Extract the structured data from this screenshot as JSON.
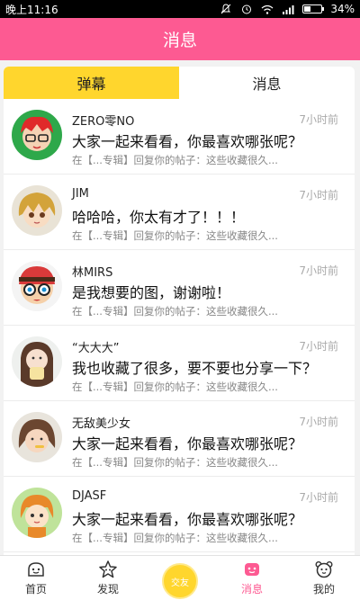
{
  "status_bar": {
    "time": "晚上11:16",
    "battery": "34%",
    "battery_level": 0.34
  },
  "header": {
    "title": "消息"
  },
  "tabs": [
    {
      "label": "弹幕",
      "active": true
    },
    {
      "label": "消息",
      "active": false
    }
  ],
  "messages": [
    {
      "user": "ZERO零NO",
      "time": "7小时前",
      "text": "大家一起来看看，你最喜欢哪张呢？",
      "sub": "在【...专辑】回复你的帖子：这些收藏很久..."
    },
    {
      "user": "JIM",
      "time": "7小时前",
      "text": "哈哈哈，你太有才了！！！",
      "sub": "在【...专辑】回复你的帖子：这些收藏很久..."
    },
    {
      "user": "林MIRS",
      "time": "7小时前",
      "text": "是我想要的图，谢谢啦！",
      "sub": "在【...专辑】回复你的帖子：这些收藏很久..."
    },
    {
      "user": "“大大大”",
      "time": "7小时前",
      "text": "我也收藏了很多，要不要也分享一下？",
      "sub": "在【...专辑】回复你的帖子：这些收藏很久..."
    },
    {
      "user": "无敌美少女",
      "time": "7小时前",
      "text": "大家一起来看看，你最喜欢哪张呢？",
      "sub": "在【...专辑】回复你的帖子：这些收藏很久..."
    },
    {
      "user": "DJASF",
      "time": "7小时前",
      "text": "大家一起来看看，你最喜欢哪张呢？",
      "sub": "在【...专辑】回复你的帖子：这些收藏很久..."
    }
  ],
  "bottom_nav": {
    "home": "首页",
    "discover": "发现",
    "center": "交友",
    "messages": "消息",
    "mine": "我的"
  },
  "colors": {
    "accent": "#fd5a92",
    "tab_active": "#ffd62d"
  }
}
